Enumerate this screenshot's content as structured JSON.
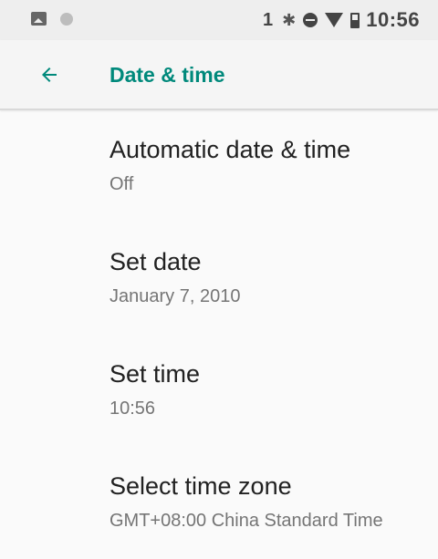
{
  "status_bar": {
    "left_icons": [
      "gallery-notification-icon",
      "circle-notification-icon"
    ],
    "sim_label": "1",
    "right_icons": [
      "bluetooth-icon",
      "do-not-disturb-icon",
      "wifi-icon",
      "battery-icon"
    ],
    "time": "10:56"
  },
  "app_bar": {
    "back_icon": "arrow-left-icon",
    "title": "Date & time"
  },
  "preferences": [
    {
      "title": "Automatic date & time",
      "summary": "Off"
    },
    {
      "title": "Set date",
      "summary": "January 7, 2010"
    },
    {
      "title": "Set time",
      "summary": "10:56"
    },
    {
      "title": "Select time zone",
      "summary": "GMT+08:00 China Standard Time"
    }
  ],
  "colors": {
    "accent": "#00897b",
    "status_bar_bg": "#eeeeee",
    "app_bar_bg": "#f5f5f5",
    "background": "#fafafa",
    "primary_text": "#212121",
    "secondary_text": "#757575"
  }
}
